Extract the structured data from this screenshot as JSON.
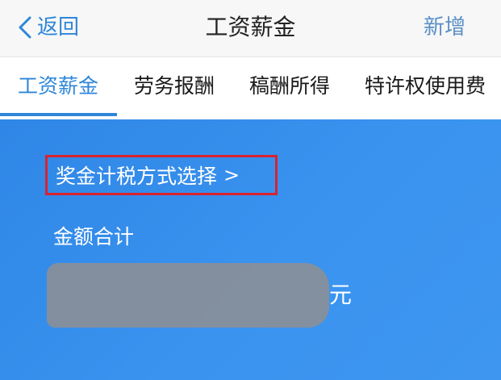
{
  "navbar": {
    "back_label": "返回",
    "title": "工资薪金",
    "add_label": "新增"
  },
  "tabs": [
    {
      "label": "工资薪金",
      "active": true
    },
    {
      "label": "劳务报酬",
      "active": false
    },
    {
      "label": "稿酬所得",
      "active": false
    },
    {
      "label": "特许权使用费",
      "active": false
    }
  ],
  "card": {
    "bonus_method_label": "奖金计税方式选择",
    "bonus_method_chevron": ">",
    "amount_label": "金额合计",
    "amount_unit": "元"
  },
  "colors": {
    "accent": "#2e86d9",
    "card_blue": "#3a93ef",
    "highlight_red": "#d8232f"
  }
}
